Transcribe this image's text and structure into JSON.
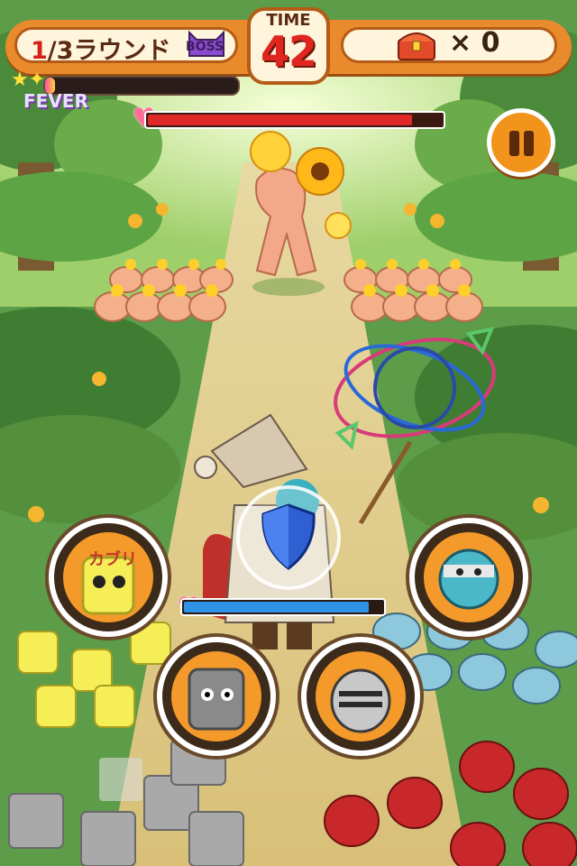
{
  "hud": {
    "round_current": "1",
    "round_rest": "/3ラウンド",
    "boss_label": "BOSS",
    "time_label": "TIME",
    "time_value": "42",
    "chest_count": "× 0",
    "fever_label": "FEVER",
    "fever_level": 0.05
  },
  "boss": {
    "hp_fraction": 0.9
  },
  "player": {
    "hp_fraction": 0.93
  },
  "skills": [
    {
      "name": "yellow-chick-monster",
      "text": "カブリ"
    },
    {
      "name": "rock-golem"
    },
    {
      "name": "armored-knight"
    },
    {
      "name": "ninja-healer"
    }
  ],
  "colors": {
    "hud_orange": "#e98a2c",
    "boss_hp": "#e02a2a",
    "player_hp": "#2e92e6",
    "time_red": "#e0261e"
  }
}
